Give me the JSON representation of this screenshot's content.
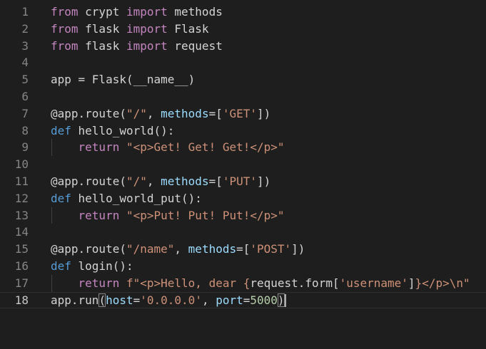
{
  "editor": {
    "language": "python",
    "active_line": "18",
    "colors": {
      "background": "#1e1e1e",
      "keyword": "#c586c0",
      "def_keyword": "#569cd6",
      "function": "#dcdcaa",
      "variable": "#9cdcfe",
      "string": "#ce9178",
      "number": "#b5cea8",
      "plain": "#d4d4d4",
      "line_number": "#858585"
    },
    "lines": [
      {
        "num": "1",
        "tokens": [
          {
            "t": "from",
            "c": "kw"
          },
          {
            "t": " crypt ",
            "c": "plain"
          },
          {
            "t": "import",
            "c": "kw"
          },
          {
            "t": " methods",
            "c": "plain"
          }
        ]
      },
      {
        "num": "2",
        "tokens": [
          {
            "t": "from",
            "c": "kw"
          },
          {
            "t": " flask ",
            "c": "plain"
          },
          {
            "t": "import",
            "c": "kw"
          },
          {
            "t": " Flask",
            "c": "plain"
          }
        ]
      },
      {
        "num": "3",
        "tokens": [
          {
            "t": "from",
            "c": "kw"
          },
          {
            "t": " flask ",
            "c": "plain"
          },
          {
            "t": "import",
            "c": "kw"
          },
          {
            "t": " request",
            "c": "plain"
          }
        ]
      },
      {
        "num": "4",
        "tokens": []
      },
      {
        "num": "5",
        "tokens": [
          {
            "t": "app = Flask(__name__)",
            "c": "plain"
          }
        ]
      },
      {
        "num": "6",
        "tokens": []
      },
      {
        "num": "7",
        "tokens": [
          {
            "t": "@app.route(",
            "c": "plain"
          },
          {
            "t": "\"/\"",
            "c": "str"
          },
          {
            "t": ", ",
            "c": "plain"
          },
          {
            "t": "methods",
            "c": "var"
          },
          {
            "t": "=[",
            "c": "plain"
          },
          {
            "t": "'GET'",
            "c": "str"
          },
          {
            "t": "])",
            "c": "plain"
          }
        ]
      },
      {
        "num": "8",
        "tokens": [
          {
            "t": "def",
            "c": "def"
          },
          {
            "t": " hello_world():",
            "c": "plain"
          }
        ]
      },
      {
        "num": "9",
        "tokens": [
          {
            "t": "    ",
            "c": "plain"
          },
          {
            "t": "return",
            "c": "kw"
          },
          {
            "t": " ",
            "c": "plain"
          },
          {
            "t": "\"<p>Get! Get! Get!</p>\"",
            "c": "str"
          }
        ],
        "guide": true
      },
      {
        "num": "10",
        "tokens": []
      },
      {
        "num": "11",
        "tokens": [
          {
            "t": "@app.route(",
            "c": "plain"
          },
          {
            "t": "\"/\"",
            "c": "str"
          },
          {
            "t": ", ",
            "c": "plain"
          },
          {
            "t": "methods",
            "c": "var"
          },
          {
            "t": "=[",
            "c": "plain"
          },
          {
            "t": "'PUT'",
            "c": "str"
          },
          {
            "t": "])",
            "c": "plain"
          }
        ]
      },
      {
        "num": "12",
        "tokens": [
          {
            "t": "def",
            "c": "def"
          },
          {
            "t": " hello_world_put():",
            "c": "plain"
          }
        ]
      },
      {
        "num": "13",
        "tokens": [
          {
            "t": "    ",
            "c": "plain"
          },
          {
            "t": "return",
            "c": "kw"
          },
          {
            "t": " ",
            "c": "plain"
          },
          {
            "t": "\"<p>Put! Put! Put!</p>\"",
            "c": "str"
          }
        ],
        "guide": true
      },
      {
        "num": "14",
        "tokens": []
      },
      {
        "num": "15",
        "tokens": [
          {
            "t": "@app.route(",
            "c": "plain"
          },
          {
            "t": "\"/name\"",
            "c": "str"
          },
          {
            "t": ", ",
            "c": "plain"
          },
          {
            "t": "methods",
            "c": "var"
          },
          {
            "t": "=[",
            "c": "plain"
          },
          {
            "t": "'POST'",
            "c": "str"
          },
          {
            "t": "])",
            "c": "plain"
          }
        ]
      },
      {
        "num": "16",
        "tokens": [
          {
            "t": "def",
            "c": "def"
          },
          {
            "t": " login():",
            "c": "plain"
          }
        ]
      },
      {
        "num": "17",
        "tokens": [
          {
            "t": "    ",
            "c": "plain"
          },
          {
            "t": "return",
            "c": "kw"
          },
          {
            "t": " ",
            "c": "plain"
          },
          {
            "t": "f\"<p>Hello, dear {",
            "c": "str"
          },
          {
            "t": "request.form[",
            "c": "plain"
          },
          {
            "t": "'username'",
            "c": "str"
          },
          {
            "t": "]",
            "c": "plain"
          },
          {
            "t": "}</p>\\n\"",
            "c": "str"
          }
        ],
        "guide": true
      },
      {
        "num": "18",
        "tokens": [
          {
            "t": "app.run",
            "c": "plain"
          },
          {
            "t": "(",
            "c": "bracket"
          },
          {
            "t": "host",
            "c": "var"
          },
          {
            "t": "=",
            "c": "plain"
          },
          {
            "t": "'0.0.0.0'",
            "c": "str"
          },
          {
            "t": ", ",
            "c": "plain"
          },
          {
            "t": "port",
            "c": "var"
          },
          {
            "t": "=",
            "c": "plain"
          },
          {
            "t": "5000",
            "c": "num"
          },
          {
            "t": ")",
            "c": "bracket"
          },
          {
            "t": "",
            "c": "caret"
          }
        ]
      }
    ]
  }
}
